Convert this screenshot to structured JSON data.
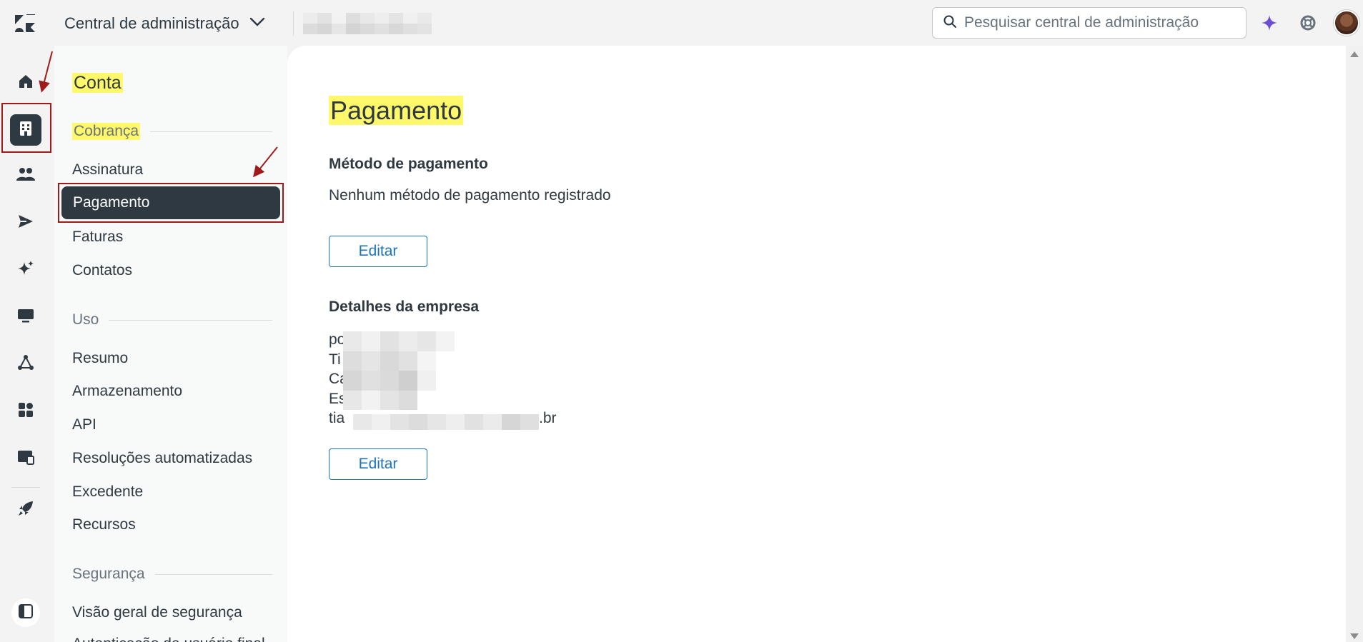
{
  "header": {
    "product_title": "Central de administração",
    "search_placeholder": "Pesquisar central de administração"
  },
  "subnav": {
    "heading": "Conta",
    "sections": [
      {
        "title": "Cobrança",
        "items": [
          "Assinatura",
          "Pagamento",
          "Faturas",
          "Contatos"
        ]
      },
      {
        "title": "Uso",
        "items": [
          "Resumo",
          "Armazenamento",
          "API",
          "Resoluções automatizadas",
          "Excedente",
          "Recursos"
        ]
      },
      {
        "title": "Segurança",
        "items": [
          "Visão geral de segurança",
          "Autenticação de usuário final"
        ]
      }
    ],
    "active_item": "Pagamento"
  },
  "main": {
    "page_title": "Pagamento",
    "payment_method": {
      "heading": "Método de pagamento",
      "text": "Nenhum método de pagamento registrado",
      "edit_label": "Editar"
    },
    "company_details": {
      "heading": "Detalhes da empresa",
      "lines": [
        "po",
        "Ti",
        "Ca",
        "Es",
        "tia"
      ],
      "email_suffix": ".br",
      "edit_label": "Editar"
    }
  },
  "icons": {
    "logo": "zendesk-logo-icon",
    "product_dropdown": "chevron-down-icon",
    "search": "search-icon",
    "ai": "sparkle-icon",
    "help": "lifebuoy-icon",
    "rail": [
      "home-icon",
      "building-icon",
      "people-icon",
      "send-icon",
      "sparkles-icon",
      "chat-icon",
      "objects-icon",
      "apps-icon",
      "workspace-icon",
      "rocket-icon",
      "panel-toggle-icon"
    ]
  },
  "colors": {
    "highlight": "#fff86b",
    "accent": "#1f73b7",
    "active_nav": "#2f3941",
    "ai_purple": "#6a4fd6",
    "annotation": "#a11a1a"
  }
}
